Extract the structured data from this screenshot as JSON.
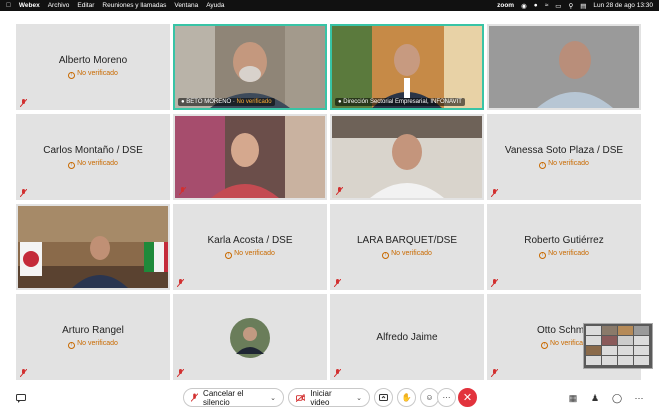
{
  "menubar": {
    "app": "Webex",
    "items": [
      "Archivo",
      "Editar",
      "Reuniones y llamadas",
      "Ventana",
      "Ayuda"
    ],
    "zoom": "zoom",
    "datetime": "Lun 28 de ago  13:30"
  },
  "not_verified": "No verificado",
  "tiles": [
    {
      "name": "Alberto Moreno",
      "status": "No verificado"
    },
    {
      "name": "BETO MORENO",
      "status": "No verificado"
    },
    {
      "name": "Dirección Sectorial Empresarial, INFONAVIT"
    },
    {
      "name": ""
    },
    {
      "name": "Carlos Montaño / DSE",
      "status": "No verificado"
    },
    {
      "name": ""
    },
    {
      "name": ""
    },
    {
      "name": "Vanessa Soto Plaza / DSE",
      "status": "No verificado"
    },
    {
      "name": ""
    },
    {
      "name": "Karla Acosta / DSE",
      "status": "No verificado"
    },
    {
      "name": "LARA BARQUET/DSE",
      "status": "No verificado"
    },
    {
      "name": "Roberto Gutiérrez",
      "status": "No verificado"
    },
    {
      "name": "Arturo Rangel",
      "status": "No verificado"
    },
    {
      "name": ""
    },
    {
      "name": "Alfredo Jaime"
    },
    {
      "name": "Otto Schm",
      "status": "No verificado"
    }
  ],
  "toolbar": {
    "unmute_label": "Cancelar el silencio",
    "video_label": "Iniciar video",
    "more_label": "···"
  },
  "colors": {
    "accent_border": "#38c4a6",
    "warning": "#c96a00",
    "end_call": "#e2333d",
    "tile_bg": "#e2e2e2"
  }
}
